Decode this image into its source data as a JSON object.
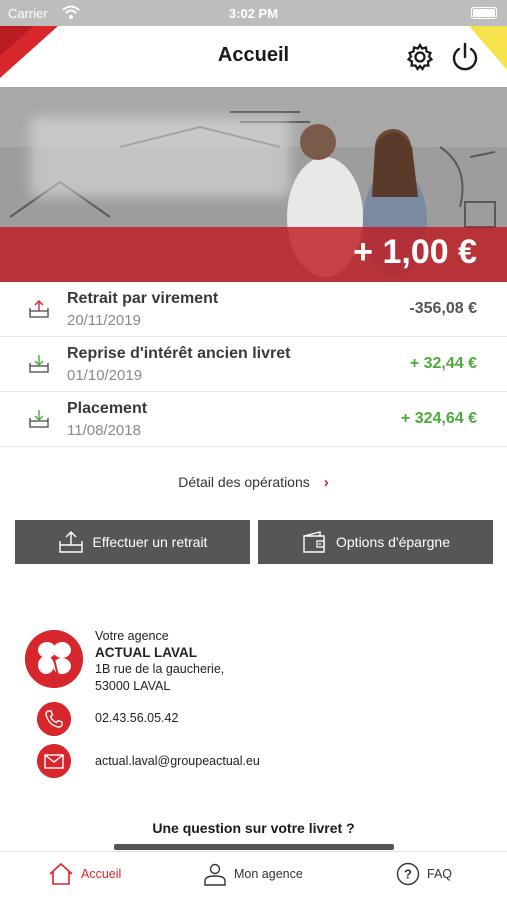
{
  "status_bar": {
    "carrier": "Carrier",
    "time": "3:02 PM"
  },
  "header": {
    "title": "Accueil"
  },
  "hero": {
    "balance": "+ 1,00 €"
  },
  "operations": [
    {
      "label": "Retrait par virement",
      "date": "20/11/2019",
      "amount": "-356,08 €",
      "type": "withdrawal"
    },
    {
      "label": "Reprise d'intérêt ancien livret",
      "date": "01/10/2019",
      "amount": "+ 32,44 €",
      "type": "deposit"
    },
    {
      "label": "Placement",
      "date": "11/08/2018",
      "amount": "+ 324,64 €",
      "type": "deposit"
    }
  ],
  "detail_link": "Détail des opérations",
  "actions": {
    "retrait": "Effectuer un retrait",
    "epargne": "Options d'épargne"
  },
  "agency": {
    "heading": "Votre agence",
    "name": "ACTUAL LAVAL",
    "address1": "1B rue de la gaucherie,",
    "address2": "53000 LAVAL",
    "phone": "02.43.56.05.42",
    "email": "actual.laval@groupeactual.eu"
  },
  "question": "Une question sur votre livret ?",
  "tabs": {
    "accueil": "Accueil",
    "agence": "Mon agence",
    "faq": "FAQ"
  },
  "colors": {
    "brand_red": "#d7262c",
    "positive_green": "#4caa3c",
    "button_gray": "#565656",
    "accent_yellow": "#f6e24a"
  },
  "icons": {
    "settings": "gear-icon",
    "logout": "power-icon",
    "withdrawal": "upload-tray-icon",
    "deposit": "download-tray-icon",
    "chevron": "chevron-right-icon",
    "agency_logo": "clover-icon",
    "phone": "phone-icon",
    "mail": "mail-icon",
    "home": "home-icon",
    "person": "person-icon",
    "faq": "question-icon"
  }
}
